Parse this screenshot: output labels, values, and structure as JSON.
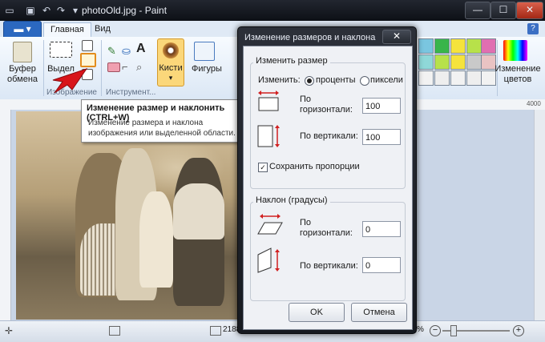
{
  "window": {
    "title": "photoOld.jpg - Paint",
    "minimize_glyph": "—",
    "maximize_glyph": "☐",
    "close_glyph": "✕"
  },
  "ribbon": {
    "tabs": [
      {
        "label": "Главная"
      },
      {
        "label": "Вид"
      }
    ],
    "clipboard": {
      "label_line1": "Буфер",
      "label_line2": "обмена"
    },
    "select_label": "Выдел",
    "brushes_label": "Кисти",
    "shapes_label": "Фигуры",
    "edit_colors_line1": "Изменение",
    "edit_colors_line2": "цветов",
    "group_image": "Изображение",
    "group_tools": "Инструмент...",
    "palette": [
      "#39b54a",
      "#f5e33c",
      "#b7e14a",
      "#e06fb1",
      "#c9c9c9",
      "#e9c3c3",
      "#8fd8d8",
      "#4aa7e0",
      "#2f3f9f",
      "#a64fa6",
      "#f2f2f2",
      "#eeeeee"
    ]
  },
  "ruler": {
    "mark_4000": "4000"
  },
  "tooltip": {
    "title": "Изменение размер и наклонить (CTRL+W)",
    "body": "Изменение размера и наклона изображения или выделенной области."
  },
  "status": {
    "size_text": "2188",
    "zoom_text": "%"
  },
  "dialog": {
    "title": "Изменение размеров и наклона",
    "resize_legend": "Изменить размер",
    "by_label": "Изменить:",
    "percent_label": "проценты",
    "pixels_label": "пиксели",
    "horizontal_line1": "По",
    "horizontal_line2": "горизонтали:",
    "horizontal_value": "100",
    "vertical_label": "По вертикали:",
    "vertical_value": "100",
    "keep_ratio_label": "Сохранить пропорции",
    "skew_legend": "Наклон (градусы)",
    "skew_h_line1": "По",
    "skew_h_line2": "горизонтали:",
    "skew_h_value": "0",
    "skew_v_label": "По вертикали:",
    "skew_v_value": "0",
    "ok_label": "OK",
    "cancel_label": "Отмена"
  }
}
